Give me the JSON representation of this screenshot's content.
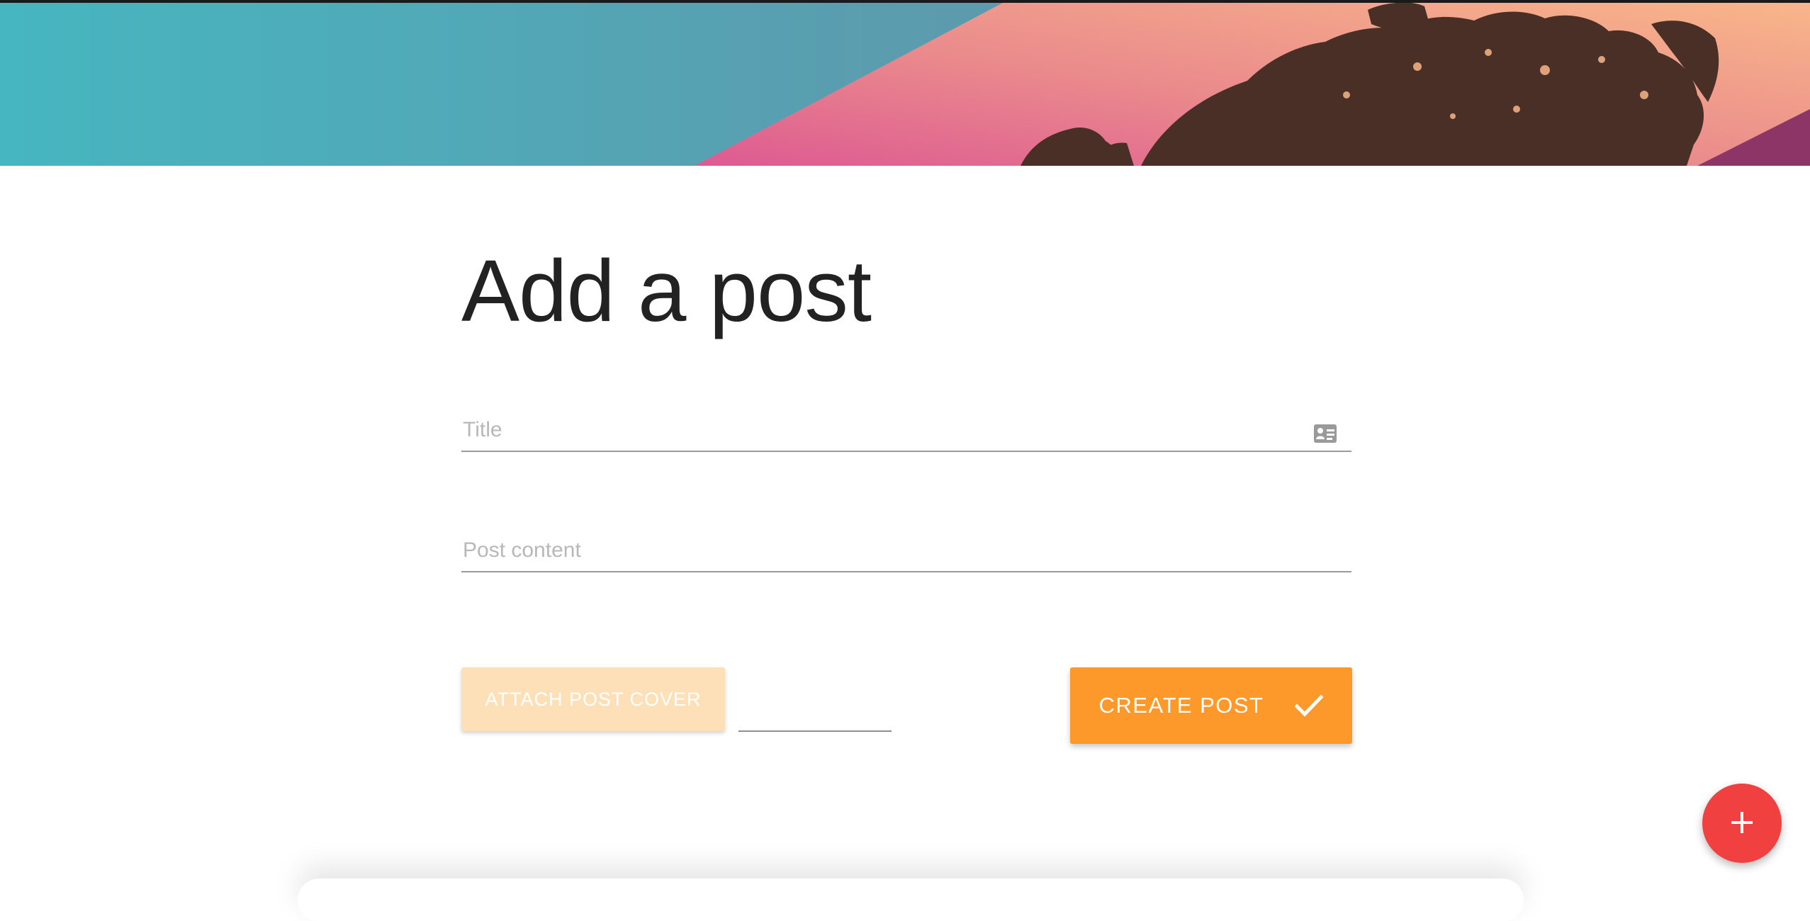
{
  "page": {
    "title": "Add a post"
  },
  "form": {
    "title_placeholder": "Title",
    "content_placeholder": "Post content",
    "attach_label": "ATTACH POST COVER",
    "create_label": "CREATE POST"
  },
  "icons": {
    "title_field_icon": "id-card-icon",
    "create_icon": "checkmark-icon",
    "fab_icon": "plus-icon"
  },
  "colors": {
    "hero_left": "#49b5c0",
    "hero_mid": "#e0618f",
    "hero_right": "#f9b88a",
    "palm": "#4a2f26",
    "attach_bg": "#fde0b7",
    "create_bg": "#fd982b",
    "fab_bg": "#f0403f"
  }
}
